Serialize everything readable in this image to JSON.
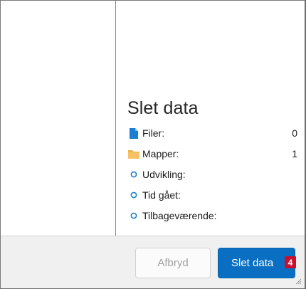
{
  "dialog": {
    "title": "Slet data",
    "rows": [
      {
        "icon": "file-icon",
        "label": "Filer:",
        "value": "0"
      },
      {
        "icon": "folder-icon",
        "label": "Mapper:",
        "value": "1"
      },
      {
        "icon": "status-circle-icon",
        "label": "Udvikling:",
        "value": ""
      },
      {
        "icon": "status-circle-icon",
        "label": "Tid gået:",
        "value": ""
      },
      {
        "icon": "status-circle-icon",
        "label": "Tilbageværende:",
        "value": ""
      }
    ]
  },
  "footer": {
    "cancel_label": "Afbryd",
    "delete_label": "Slet data",
    "badge": "4"
  },
  "colors": {
    "accent": "#0a6fc2",
    "folder": "#f0b24a",
    "badge": "#c8102e",
    "file": "#1a7fd0"
  }
}
